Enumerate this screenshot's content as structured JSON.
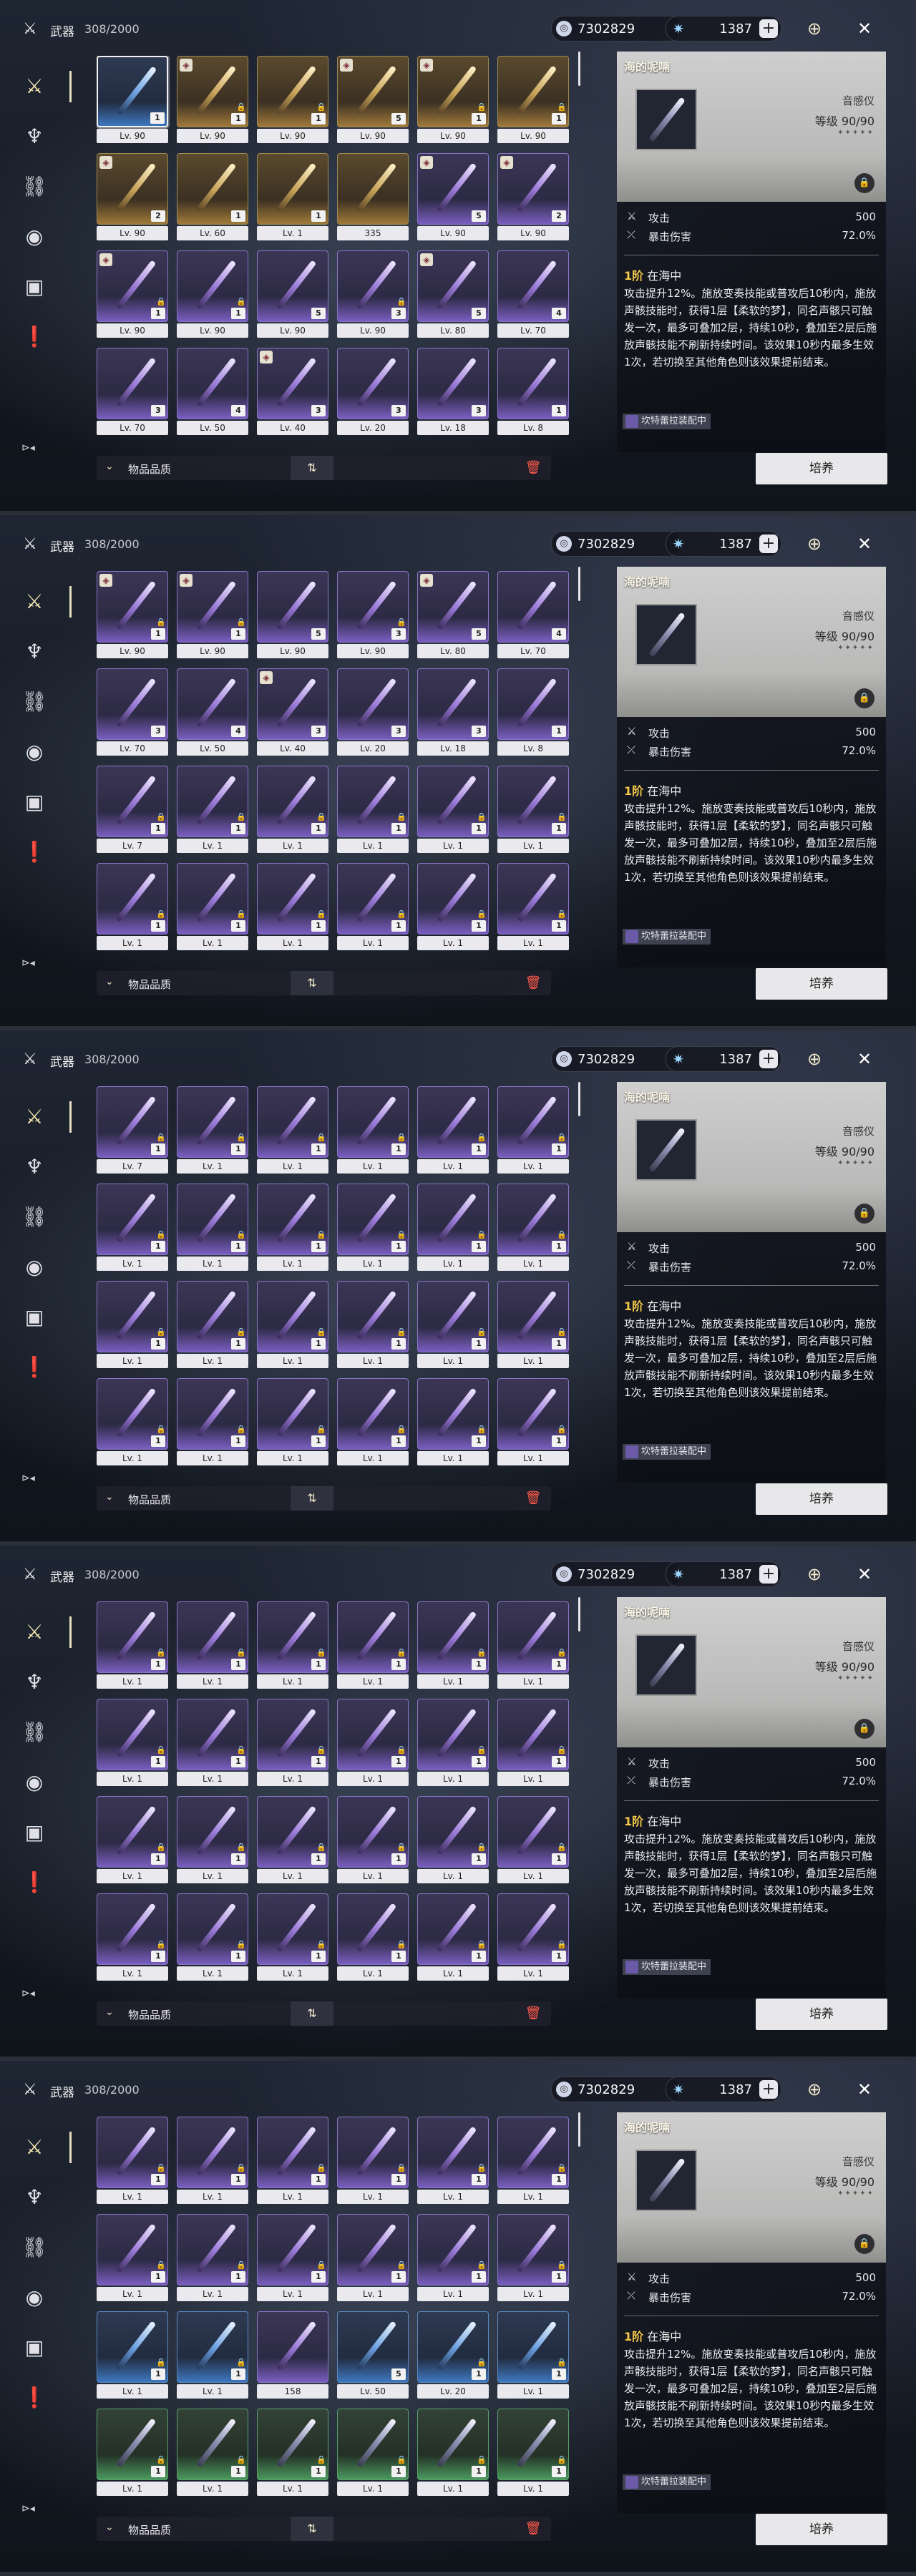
{
  "colors": {
    "accent": "#f4e8b0",
    "rank": "#f4c84a",
    "trash": "#ff5a4a"
  },
  "header": {
    "title": "武器",
    "count": "308/2000",
    "currency1": "7302829",
    "currency2": "1387",
    "plus": "+"
  },
  "icons": {
    "title": "crossed-swords-icon",
    "currency1": "union-coin-icon",
    "currency2": "astrite-icon",
    "target": "target-icon",
    "close": "close-icon"
  },
  "sidebar": {
    "items": [
      "weapon",
      "echo",
      "dev-item",
      "resource",
      "supply",
      "special"
    ],
    "bottom": "⊳◂"
  },
  "filter": {
    "label": "物品品质",
    "sort_icon": "⇅",
    "chevron": "⌄"
  },
  "panel": {
    "name": "海的呢喃",
    "type": "音感仪",
    "level": "等级 90/90",
    "stars": "✦✦✦✦✦",
    "stat1_label": "攻击",
    "stat1_value": "500",
    "stat2_label": "暴击伤害",
    "stat2_value": "72.0%",
    "skill_rank": "1阶",
    "skill_name": "在海中",
    "skill_desc": "攻击提升12%。施放变奏技能或普攻后10秒内，施放声骸技能时，获得1层【柔软的梦】，同名声骸只可触发一次，最多可叠加2层，持续10秒，叠加至2层后施放声骸技能不刷新持续时间。该效果10秒内最多生效1次，若切换至其他角色则该效果提前结束。",
    "equip": "坎特蕾拉装配中",
    "cultivate": "培养"
  },
  "sections": [
    {
      "grid": [
        {
          "lv": "Lv. 90",
          "n": "1",
          "t": "blue",
          "sel": true
        },
        {
          "lv": "Lv. 90",
          "n": "1",
          "t": "gold",
          "lock": true,
          "c": true
        },
        {
          "lv": "Lv. 90",
          "n": "1",
          "t": "gold",
          "lock": true
        },
        {
          "lv": "Lv. 90",
          "n": "5",
          "t": "gold",
          "c": true
        },
        {
          "lv": "Lv. 90",
          "n": "1",
          "t": "gold",
          "lock": true,
          "c": true
        },
        {
          "lv": "Lv. 90",
          "n": "1",
          "t": "gold",
          "lock": true
        },
        {
          "lv": "Lv. 90",
          "n": "2",
          "t": "gold",
          "c": true
        },
        {
          "lv": "Lv. 60",
          "n": "1",
          "t": "gold"
        },
        {
          "lv": "Lv. 1",
          "n": "1",
          "t": "gold"
        },
        {
          "lv": "335",
          "n": "",
          "t": "gold"
        },
        {
          "lv": "Lv. 90",
          "n": "5",
          "t": "purple",
          "c": true
        },
        {
          "lv": "Lv. 90",
          "n": "2",
          "t": "purple",
          "c": true
        },
        {
          "lv": "Lv. 90",
          "n": "1",
          "t": "purple",
          "lock": true,
          "c": true
        },
        {
          "lv": "Lv. 90",
          "n": "1",
          "t": "purple",
          "lock": true
        },
        {
          "lv": "Lv. 90",
          "n": "5",
          "t": "purple"
        },
        {
          "lv": "Lv. 90",
          "n": "3",
          "t": "purple",
          "lock": true
        },
        {
          "lv": "Lv. 80",
          "n": "5",
          "t": "purple",
          "c": true
        },
        {
          "lv": "Lv. 70",
          "n": "4",
          "t": "purple"
        },
        {
          "lv": "Lv. 70",
          "n": "3",
          "t": "purple"
        },
        {
          "lv": "Lv. 50",
          "n": "4",
          "t": "purple"
        },
        {
          "lv": "Lv. 40",
          "n": "3",
          "t": "purple",
          "c": true
        },
        {
          "lv": "Lv. 20",
          "n": "3",
          "t": "purple"
        },
        {
          "lv": "Lv. 18",
          "n": "3",
          "t": "purple"
        },
        {
          "lv": "Lv. 8",
          "n": "1",
          "t": "purple"
        }
      ]
    },
    {
      "grid": [
        {
          "lv": "Lv. 90",
          "n": "1",
          "t": "purple",
          "lock": true,
          "c": true
        },
        {
          "lv": "Lv. 90",
          "n": "1",
          "t": "purple",
          "lock": true,
          "c": true
        },
        {
          "lv": "Lv. 90",
          "n": "5",
          "t": "purple"
        },
        {
          "lv": "Lv. 90",
          "n": "3",
          "t": "purple",
          "lock": true
        },
        {
          "lv": "Lv. 80",
          "n": "5",
          "t": "purple",
          "c": true
        },
        {
          "lv": "Lv. 70",
          "n": "4",
          "t": "purple"
        },
        {
          "lv": "Lv. 70",
          "n": "3",
          "t": "purple"
        },
        {
          "lv": "Lv. 50",
          "n": "4",
          "t": "purple"
        },
        {
          "lv": "Lv. 40",
          "n": "3",
          "t": "purple",
          "c": true
        },
        {
          "lv": "Lv. 20",
          "n": "3",
          "t": "purple"
        },
        {
          "lv": "Lv. 18",
          "n": "3",
          "t": "purple"
        },
        {
          "lv": "Lv. 8",
          "n": "1",
          "t": "purple"
        },
        {
          "lv": "Lv. 7",
          "n": "1",
          "t": "purple",
          "lock": true
        },
        {
          "lv": "Lv. 1",
          "n": "1",
          "t": "purple",
          "lock": true
        },
        {
          "lv": "Lv. 1",
          "n": "1",
          "t": "purple",
          "lock": true
        },
        {
          "lv": "Lv. 1",
          "n": "1",
          "t": "purple",
          "lock": true
        },
        {
          "lv": "Lv. 1",
          "n": "1",
          "t": "purple",
          "lock": true
        },
        {
          "lv": "Lv. 1",
          "n": "1",
          "t": "purple",
          "lock": true
        },
        {
          "lv": "Lv. 1",
          "n": "1",
          "t": "purple",
          "lock": true
        },
        {
          "lv": "Lv. 1",
          "n": "1",
          "t": "purple",
          "lock": true
        },
        {
          "lv": "Lv. 1",
          "n": "1",
          "t": "purple",
          "lock": true
        },
        {
          "lv": "Lv. 1",
          "n": "1",
          "t": "purple",
          "lock": true
        },
        {
          "lv": "Lv. 1",
          "n": "1",
          "t": "purple",
          "lock": true
        },
        {
          "lv": "Lv. 1",
          "n": "1",
          "t": "purple",
          "lock": true
        }
      ]
    },
    {
      "grid": [
        {
          "lv": "Lv. 7",
          "n": "1",
          "t": "purple",
          "lock": true
        },
        {
          "lv": "Lv. 1",
          "n": "1",
          "t": "purple",
          "lock": true
        },
        {
          "lv": "Lv. 1",
          "n": "1",
          "t": "purple",
          "lock": true
        },
        {
          "lv": "Lv. 1",
          "n": "1",
          "t": "purple",
          "lock": true
        },
        {
          "lv": "Lv. 1",
          "n": "1",
          "t": "purple",
          "lock": true
        },
        {
          "lv": "Lv. 1",
          "n": "1",
          "t": "purple",
          "lock": true
        },
        {
          "lv": "Lv. 1",
          "n": "1",
          "t": "purple",
          "lock": true
        },
        {
          "lv": "Lv. 1",
          "n": "1",
          "t": "purple",
          "lock": true
        },
        {
          "lv": "Lv. 1",
          "n": "1",
          "t": "purple",
          "lock": true
        },
        {
          "lv": "Lv. 1",
          "n": "1",
          "t": "purple",
          "lock": true
        },
        {
          "lv": "Lv. 1",
          "n": "1",
          "t": "purple",
          "lock": true
        },
        {
          "lv": "Lv. 1",
          "n": "1",
          "t": "purple",
          "lock": true
        },
        {
          "lv": "Lv. 1",
          "n": "1",
          "t": "purple",
          "lock": true
        },
        {
          "lv": "Lv. 1",
          "n": "1",
          "t": "purple",
          "lock": true
        },
        {
          "lv": "Lv. 1",
          "n": "1",
          "t": "purple",
          "lock": true
        },
        {
          "lv": "Lv. 1",
          "n": "1",
          "t": "purple",
          "lock": true
        },
        {
          "lv": "Lv. 1",
          "n": "1",
          "t": "purple",
          "lock": true
        },
        {
          "lv": "Lv. 1",
          "n": "1",
          "t": "purple",
          "lock": true
        },
        {
          "lv": "Lv. 1",
          "n": "1",
          "t": "purple",
          "lock": true
        },
        {
          "lv": "Lv. 1",
          "n": "1",
          "t": "purple",
          "lock": true
        },
        {
          "lv": "Lv. 1",
          "n": "1",
          "t": "purple",
          "lock": true
        },
        {
          "lv": "Lv. 1",
          "n": "1",
          "t": "purple",
          "lock": true
        },
        {
          "lv": "Lv. 1",
          "n": "1",
          "t": "purple",
          "lock": true
        },
        {
          "lv": "Lv. 1",
          "n": "1",
          "t": "purple",
          "lock": true
        }
      ]
    },
    {
      "grid": [
        {
          "lv": "Lv. 1",
          "n": "1",
          "t": "purple",
          "lock": true
        },
        {
          "lv": "Lv. 1",
          "n": "1",
          "t": "purple",
          "lock": true
        },
        {
          "lv": "Lv. 1",
          "n": "1",
          "t": "purple",
          "lock": true
        },
        {
          "lv": "Lv. 1",
          "n": "1",
          "t": "purple",
          "lock": true
        },
        {
          "lv": "Lv. 1",
          "n": "1",
          "t": "purple",
          "lock": true
        },
        {
          "lv": "Lv. 1",
          "n": "1",
          "t": "purple",
          "lock": true
        },
        {
          "lv": "Lv. 1",
          "n": "1",
          "t": "purple",
          "lock": true
        },
        {
          "lv": "Lv. 1",
          "n": "1",
          "t": "purple",
          "lock": true
        },
        {
          "lv": "Lv. 1",
          "n": "1",
          "t": "purple",
          "lock": true
        },
        {
          "lv": "Lv. 1",
          "n": "1",
          "t": "purple",
          "lock": true
        },
        {
          "lv": "Lv. 1",
          "n": "1",
          "t": "purple",
          "lock": true
        },
        {
          "lv": "Lv. 1",
          "n": "1",
          "t": "purple",
          "lock": true
        },
        {
          "lv": "Lv. 1",
          "n": "1",
          "t": "purple",
          "lock": true
        },
        {
          "lv": "Lv. 1",
          "n": "1",
          "t": "purple",
          "lock": true
        },
        {
          "lv": "Lv. 1",
          "n": "1",
          "t": "purple",
          "lock": true
        },
        {
          "lv": "Lv. 1",
          "n": "1",
          "t": "purple",
          "lock": true
        },
        {
          "lv": "Lv. 1",
          "n": "1",
          "t": "purple",
          "lock": true
        },
        {
          "lv": "Lv. 1",
          "n": "1",
          "t": "purple",
          "lock": true
        },
        {
          "lv": "Lv. 1",
          "n": "1",
          "t": "purple",
          "lock": true
        },
        {
          "lv": "Lv. 1",
          "n": "1",
          "t": "purple",
          "lock": true
        },
        {
          "lv": "Lv. 1",
          "n": "1",
          "t": "purple",
          "lock": true
        },
        {
          "lv": "Lv. 1",
          "n": "1",
          "t": "purple",
          "lock": true
        },
        {
          "lv": "Lv. 1",
          "n": "1",
          "t": "purple",
          "lock": true
        },
        {
          "lv": "Lv. 1",
          "n": "1",
          "t": "purple",
          "lock": true
        }
      ]
    },
    {
      "grid": [
        {
          "lv": "Lv. 1",
          "n": "1",
          "t": "purple",
          "lock": true
        },
        {
          "lv": "Lv. 1",
          "n": "1",
          "t": "purple",
          "lock": true
        },
        {
          "lv": "Lv. 1",
          "n": "1",
          "t": "purple",
          "lock": true
        },
        {
          "lv": "Lv. 1",
          "n": "1",
          "t": "purple",
          "lock": true
        },
        {
          "lv": "Lv. 1",
          "n": "1",
          "t": "purple",
          "lock": true
        },
        {
          "lv": "Lv. 1",
          "n": "1",
          "t": "purple",
          "lock": true
        },
        {
          "lv": "Lv. 1",
          "n": "1",
          "t": "purple",
          "lock": true
        },
        {
          "lv": "Lv. 1",
          "n": "1",
          "t": "purple",
          "lock": true
        },
        {
          "lv": "Lv. 1",
          "n": "1",
          "t": "purple",
          "lock": true
        },
        {
          "lv": "Lv. 1",
          "n": "1",
          "t": "purple",
          "lock": true
        },
        {
          "lv": "Lv. 1",
          "n": "1",
          "t": "purple",
          "lock": true
        },
        {
          "lv": "Lv. 1",
          "n": "1",
          "t": "purple",
          "lock": true
        },
        {
          "lv": "Lv. 1",
          "n": "1",
          "t": "blue",
          "lock": true
        },
        {
          "lv": "Lv. 1",
          "n": "1",
          "t": "blue",
          "lock": true
        },
        {
          "lv": "158",
          "n": "",
          "t": "purple"
        },
        {
          "lv": "Lv. 50",
          "n": "5",
          "t": "blue"
        },
        {
          "lv": "Lv. 20",
          "n": "1",
          "t": "blue",
          "lock": true
        },
        {
          "lv": "Lv. 1",
          "n": "1",
          "t": "blue",
          "lock": true
        },
        {
          "lv": "Lv. 1",
          "n": "1",
          "t": "green",
          "lock": true
        },
        {
          "lv": "Lv. 1",
          "n": "1",
          "t": "green",
          "lock": true
        },
        {
          "lv": "Lv. 1",
          "n": "1",
          "t": "green",
          "lock": true
        },
        {
          "lv": "Lv. 1",
          "n": "1",
          "t": "green",
          "lock": true
        },
        {
          "lv": "Lv. 1",
          "n": "1",
          "t": "green",
          "lock": true
        },
        {
          "lv": "Lv. 1",
          "n": "1",
          "t": "green",
          "lock": true
        }
      ]
    }
  ]
}
